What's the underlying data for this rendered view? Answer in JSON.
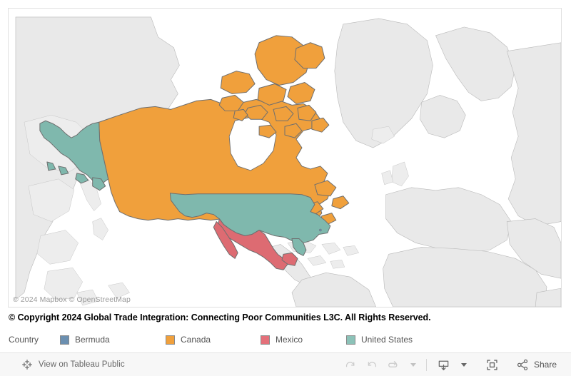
{
  "map": {
    "attribution": "© 2024 Mapbox  © OpenStreetMap",
    "background_land_color": "#e9e9e9",
    "background_border_color": "#b9b9b9",
    "ocean_color": "#ffffff",
    "highlight_border_color": "#707070",
    "countries": [
      {
        "name": "Canada",
        "color": "#f0a03c"
      },
      {
        "name": "United States",
        "color": "#7fb8ad"
      },
      {
        "name": "Mexico",
        "color": "#dd6b72"
      },
      {
        "name": "Bermuda",
        "color": "#6b8fb0"
      }
    ]
  },
  "caption": {
    "text": "© Copyright 2024 Global Trade Integration: Connecting Poor Communities L3C. All Rights Reserved."
  },
  "legend": {
    "title": "Country",
    "items": [
      {
        "label": "Bermuda",
        "color": "#6b8fb0"
      },
      {
        "label": "Canada",
        "color": "#f0a03c"
      },
      {
        "label": "Mexico",
        "color": "#e4707a"
      },
      {
        "label": "United States",
        "color": "#8cc2b8"
      }
    ]
  },
  "toolbar": {
    "view_link_label": "View on Tableau Public",
    "tableau_icon": "tableau-logo-icon",
    "buttons": [
      {
        "name": "redo-button",
        "icon": "redo-arrow-icon"
      },
      {
        "name": "undo-button",
        "icon": "undo-arrow-icon"
      },
      {
        "name": "reset-button",
        "icon": "reset-loop-icon"
      },
      {
        "name": "reset-dropdown",
        "icon": "chevron-down-icon"
      },
      {
        "name": "download-button",
        "icon": "download-tray-icon"
      },
      {
        "name": "download-dropdown",
        "icon": "chevron-down-icon"
      },
      {
        "name": "fullscreen-button",
        "icon": "fullscreen-icon"
      },
      {
        "name": "share-button",
        "icon": "share-nodes-icon"
      }
    ],
    "share_label": "Share"
  }
}
